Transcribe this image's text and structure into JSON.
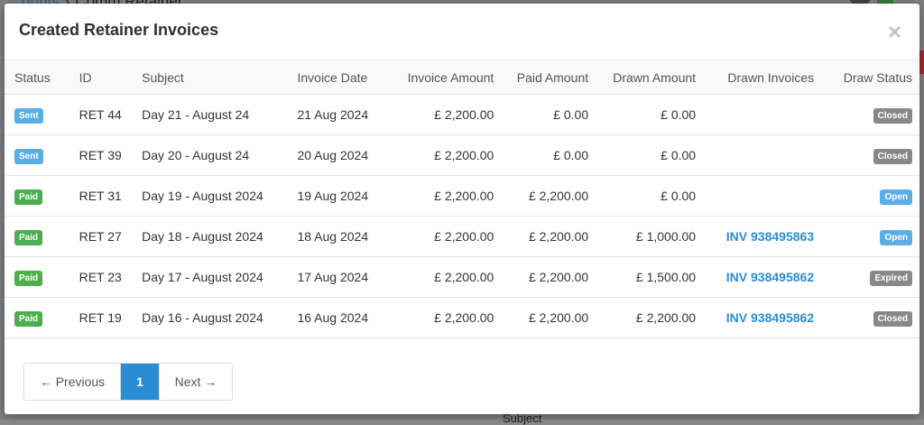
{
  "background": {
    "crumb_link": "...ounts",
    "crumb_title": "Comm Retainer",
    "subject_text": "Subject"
  },
  "modal": {
    "title": "Created Retainer Invoices",
    "close_glyph": "×"
  },
  "table": {
    "headers": {
      "status": "Status",
      "id": "ID",
      "subject": "Subject",
      "invoice_date": "Invoice Date",
      "invoice_amount": "Invoice Amount",
      "paid_amount": "Paid Amount",
      "drawn_amount": "Drawn Amount",
      "drawn_invoices": "Drawn Invoices",
      "draw_status": "Draw Status"
    },
    "rows": [
      {
        "status": "Sent",
        "id": "RET 44",
        "subject": "Day 21 - August 24",
        "invoice_date": "21 Aug 2024",
        "invoice_amount": "£ 2,200.00",
        "paid_amount": "£ 0.00",
        "drawn_amount": "£ 0.00",
        "drawn_invoices": "",
        "draw_status": "Closed"
      },
      {
        "status": "Sent",
        "id": "RET 39",
        "subject": "Day 20 - August 24",
        "invoice_date": "20 Aug 2024",
        "invoice_amount": "£ 2,200.00",
        "paid_amount": "£ 0.00",
        "drawn_amount": "£ 0.00",
        "drawn_invoices": "",
        "draw_status": "Closed"
      },
      {
        "status": "Paid",
        "id": "RET 31",
        "subject": "Day 19 - August 2024",
        "invoice_date": "19 Aug 2024",
        "invoice_amount": "£ 2,200.00",
        "paid_amount": "£ 2,200.00",
        "drawn_amount": "£ 0.00",
        "drawn_invoices": "",
        "draw_status": "Open"
      },
      {
        "status": "Paid",
        "id": "RET 27",
        "subject": "Day 18 - August 2024",
        "invoice_date": "18 Aug 2024",
        "invoice_amount": "£ 2,200.00",
        "paid_amount": "£ 2,200.00",
        "drawn_amount": "£ 1,000.00",
        "drawn_invoices": "INV 938495863",
        "draw_status": "Open"
      },
      {
        "status": "Paid",
        "id": "RET 23",
        "subject": "Day 17 - August 2024",
        "invoice_date": "17 Aug 2024",
        "invoice_amount": "£ 2,200.00",
        "paid_amount": "£ 2,200.00",
        "drawn_amount": "£ 1,500.00",
        "drawn_invoices": "INV 938495862",
        "draw_status": "Expired"
      },
      {
        "status": "Paid",
        "id": "RET 19",
        "subject": "Day 16 - August 2024",
        "invoice_date": "16 Aug 2024",
        "invoice_amount": "£ 2,200.00",
        "paid_amount": "£ 2,200.00",
        "drawn_amount": "£ 2,200.00",
        "drawn_invoices": "INV 938495862",
        "draw_status": "Closed"
      }
    ]
  },
  "pagination": {
    "previous_label": "← Previous",
    "current_page": "1",
    "next_label": "Next →"
  },
  "colors": {
    "sent": "#5aaee6",
    "paid": "#4cae4c",
    "closed": "#888888",
    "open": "#5aaee6",
    "expired": "#888888",
    "link": "#2a8dd4",
    "pager_active": "#2a8dd4"
  }
}
